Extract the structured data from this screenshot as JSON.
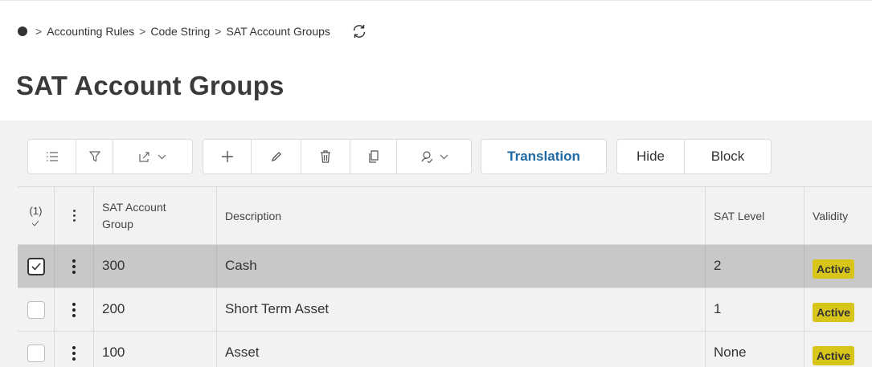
{
  "breadcrumb": {
    "items": [
      "Accounting Rules",
      "Code String",
      "SAT Account Groups"
    ],
    "separator": ">"
  },
  "page": {
    "title": "SAT Account Groups"
  },
  "toolbar": {
    "translation_label": "Translation",
    "hide_label": "Hide",
    "block_label": "Block"
  },
  "table": {
    "selected_count": "(1)",
    "columns": {
      "group_line1": "SAT Account",
      "group_line2": "Group",
      "description": "Description",
      "level": "SAT Level",
      "validity": "Validity"
    },
    "rows": [
      {
        "group": "300",
        "description": "Cash",
        "level": "2",
        "validity": "Active",
        "selected": true
      },
      {
        "group": "200",
        "description": "Short Term Asset",
        "level": "1",
        "validity": "Active",
        "selected": false
      },
      {
        "group": "100",
        "description": "Asset",
        "level": "None",
        "validity": "Active",
        "selected": false
      }
    ]
  },
  "colors": {
    "accent_link": "#1f6aa5",
    "active_badge": "#d8c51a",
    "selected_row": "#c8c8c8",
    "toolbar_bg": "#f2f2f2"
  }
}
